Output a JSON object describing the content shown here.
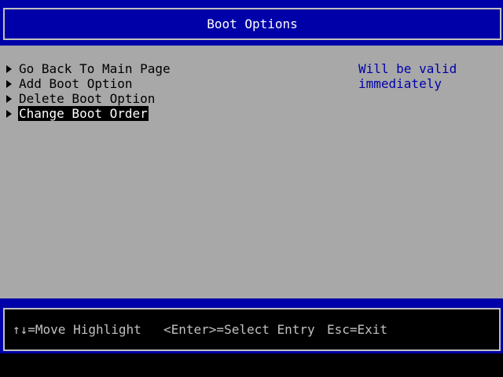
{
  "header": {
    "title": "Boot Options"
  },
  "menu": {
    "items": [
      {
        "label": "Go Back To Main Page",
        "selected": false
      },
      {
        "label": "Add Boot Option",
        "selected": false
      },
      {
        "label": "Delete Boot Option",
        "selected": false
      },
      {
        "label": "Change Boot Order",
        "selected": true
      }
    ]
  },
  "help": {
    "lines": [
      "Will be valid",
      "immediately"
    ]
  },
  "footer": {
    "move_hint": "↑↓=Move Highlight",
    "select_hint": "<Enter>=Select Entry",
    "exit_hint": "Esc=Exit"
  },
  "colors": {
    "background": "#a8a8a8",
    "header_band": "#0000a8",
    "help_text": "#0000a8",
    "highlight_bg": "#000000",
    "highlight_fg": "#ffffff"
  },
  "icons": {
    "menu_item_marker": "triangle-right-icon"
  }
}
